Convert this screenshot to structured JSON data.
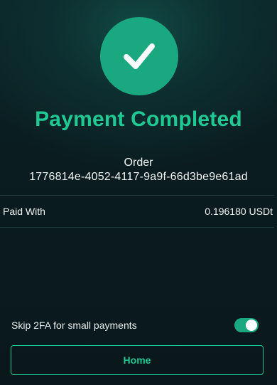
{
  "status": {
    "icon": "checkmark-icon",
    "title": "Payment Completed"
  },
  "order": {
    "label": "Order",
    "id": "1776814e-4052-4117-9a9f-66d3be9e61ad"
  },
  "payment": {
    "paid_with_label": "Paid With",
    "paid_with_value": "0.196180 USDt"
  },
  "settings": {
    "skip_2fa_label": "Skip 2FA for small payments",
    "skip_2fa_enabled": true
  },
  "actions": {
    "home_label": "Home"
  },
  "colors": {
    "accent": "#1fc994",
    "circle": "#1aa880",
    "background": "#0a1c20"
  }
}
